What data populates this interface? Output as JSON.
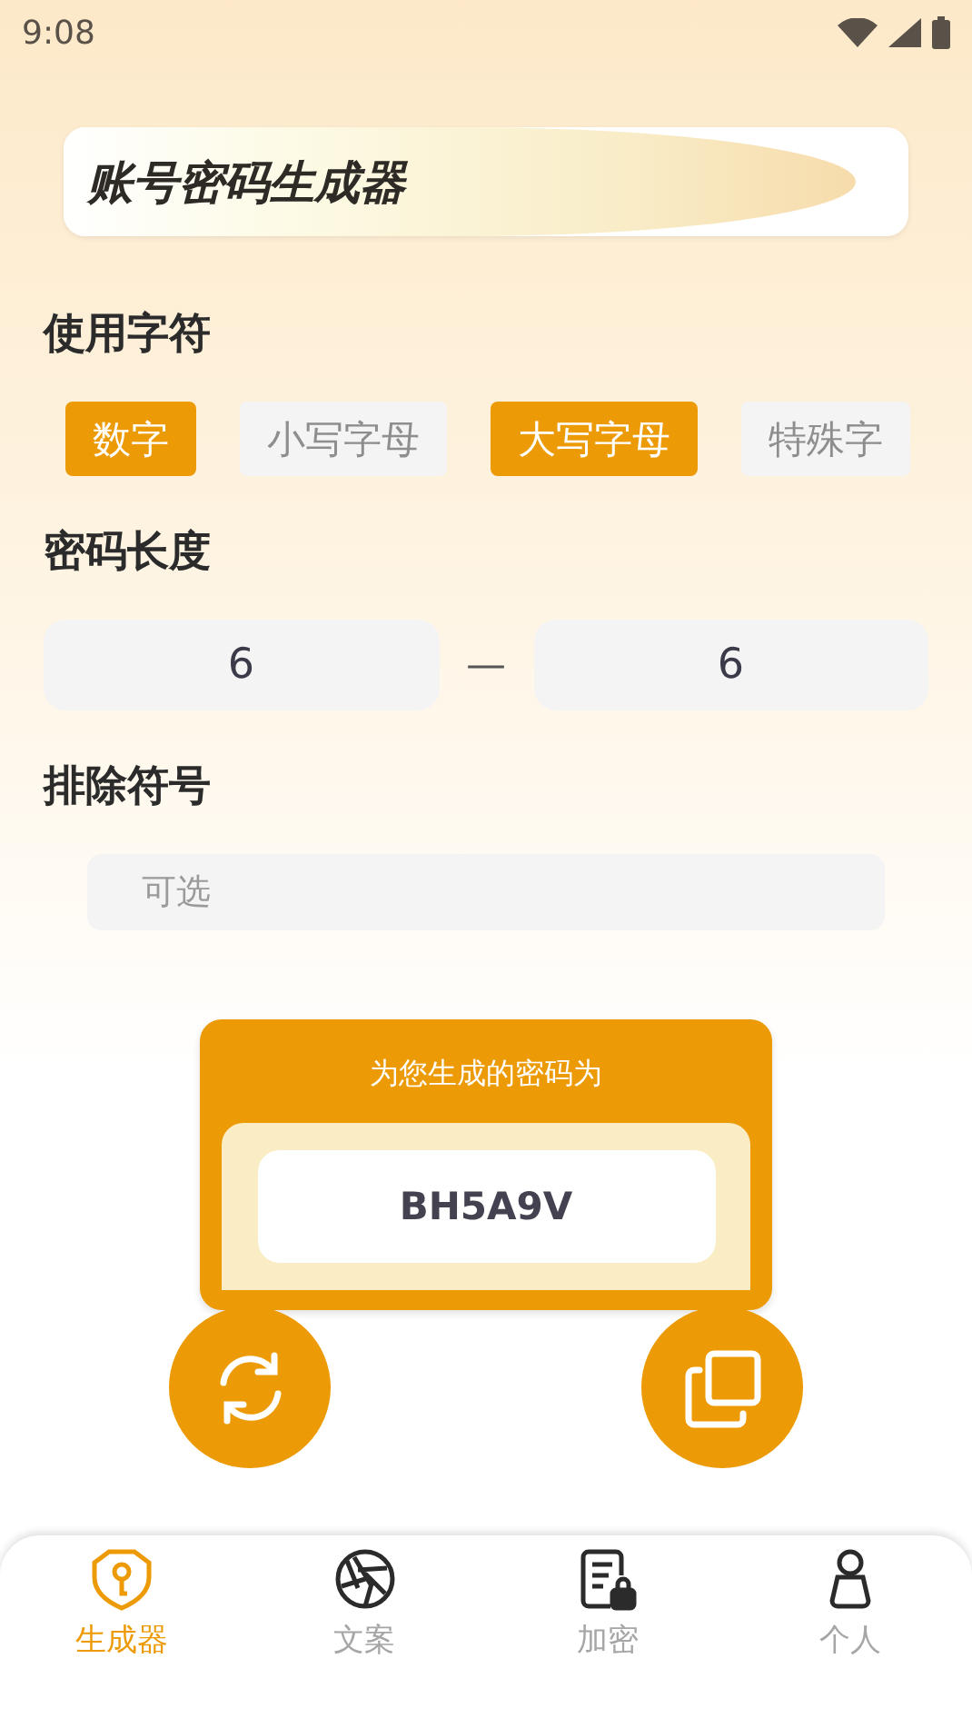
{
  "status_bar": {
    "time": "9:08"
  },
  "title": "账号密码生成器",
  "charset": {
    "label": "使用字符",
    "options": [
      {
        "label": "数字",
        "selected": true
      },
      {
        "label": "小写字母",
        "selected": false
      },
      {
        "label": "大写字母",
        "selected": true
      },
      {
        "label": "特殊字",
        "selected": false
      }
    ]
  },
  "length": {
    "label": "密码长度",
    "min": "6",
    "separator": "—",
    "max": "6"
  },
  "exclude": {
    "label": "排除符号",
    "placeholder": "可选"
  },
  "result": {
    "caption": "为您生成的密码为",
    "password": "BH5A9V"
  },
  "actions": [
    {
      "kind": "refresh"
    },
    {
      "kind": "copy"
    }
  ],
  "nav": [
    {
      "label": "生成器",
      "kind": "shield-key",
      "selected": true
    },
    {
      "label": "文案",
      "kind": "aperture",
      "selected": false
    },
    {
      "label": "加密",
      "kind": "doc-lock",
      "selected": false
    },
    {
      "label": "个人",
      "kind": "person",
      "selected": false
    }
  ]
}
